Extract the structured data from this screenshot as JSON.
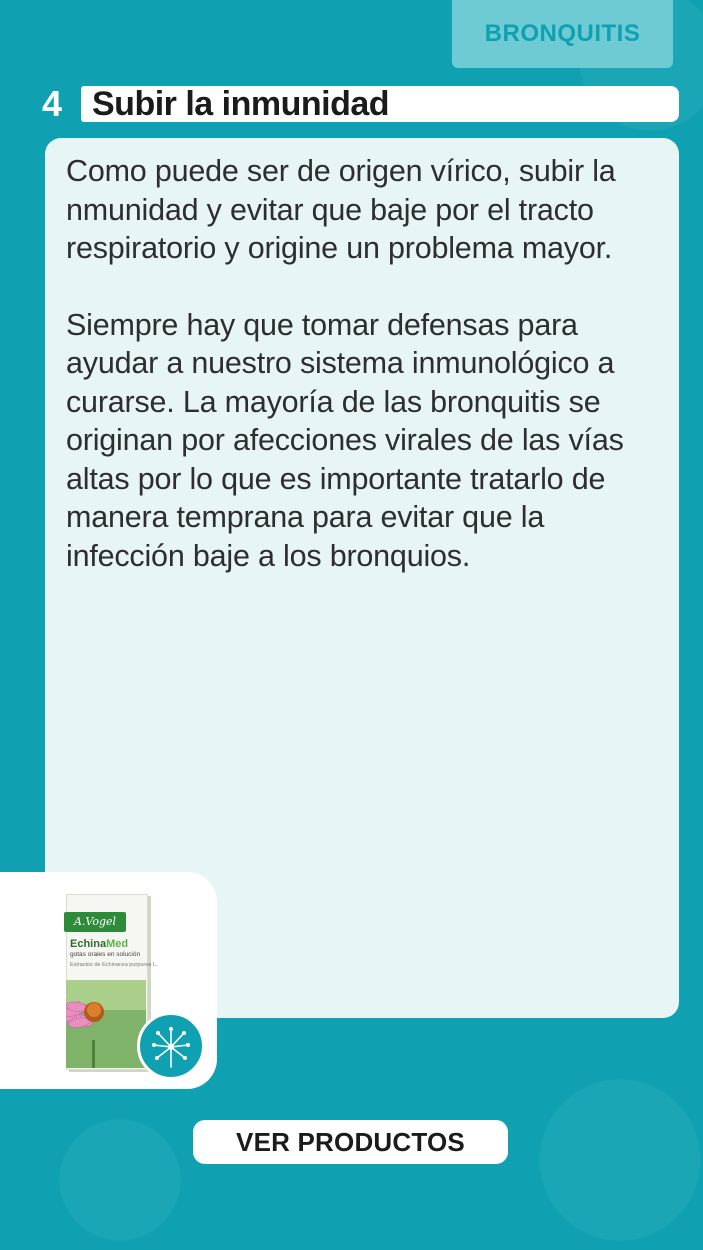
{
  "category_tag": "BRONQUITIS",
  "section": {
    "number": "4",
    "title": "Subir la inmunidad"
  },
  "content": {
    "paragraphs": [
      "Como puede ser de origen vírico, subir la nmunidad y evitar que baje por el tracto respiratorio y origine un problema mayor.",
      "Siempre hay que tomar defensas para ayudar a nuestro sistema inmunológico a curarse. La mayoría de las bronquitis se originan por afecciones virales de las vías altas por lo que es importante tratarlo de manera temprana para evitar que la infección baje a los bronquios."
    ]
  },
  "product": {
    "brand": "A.Vogel",
    "name_part1": "Echina",
    "name_part2": "Med",
    "subtitle": "gotas orales en solución",
    "extract": "Extractos de Echinacea purpurea L.",
    "badge_icon": "dandelion-icon"
  },
  "cta": {
    "label": "VER PRODUCTOS"
  },
  "colors": {
    "background": "#0fa1b2",
    "tag_background": "#6ecad3",
    "card_background": "#e7f5f5",
    "white": "#ffffff"
  }
}
